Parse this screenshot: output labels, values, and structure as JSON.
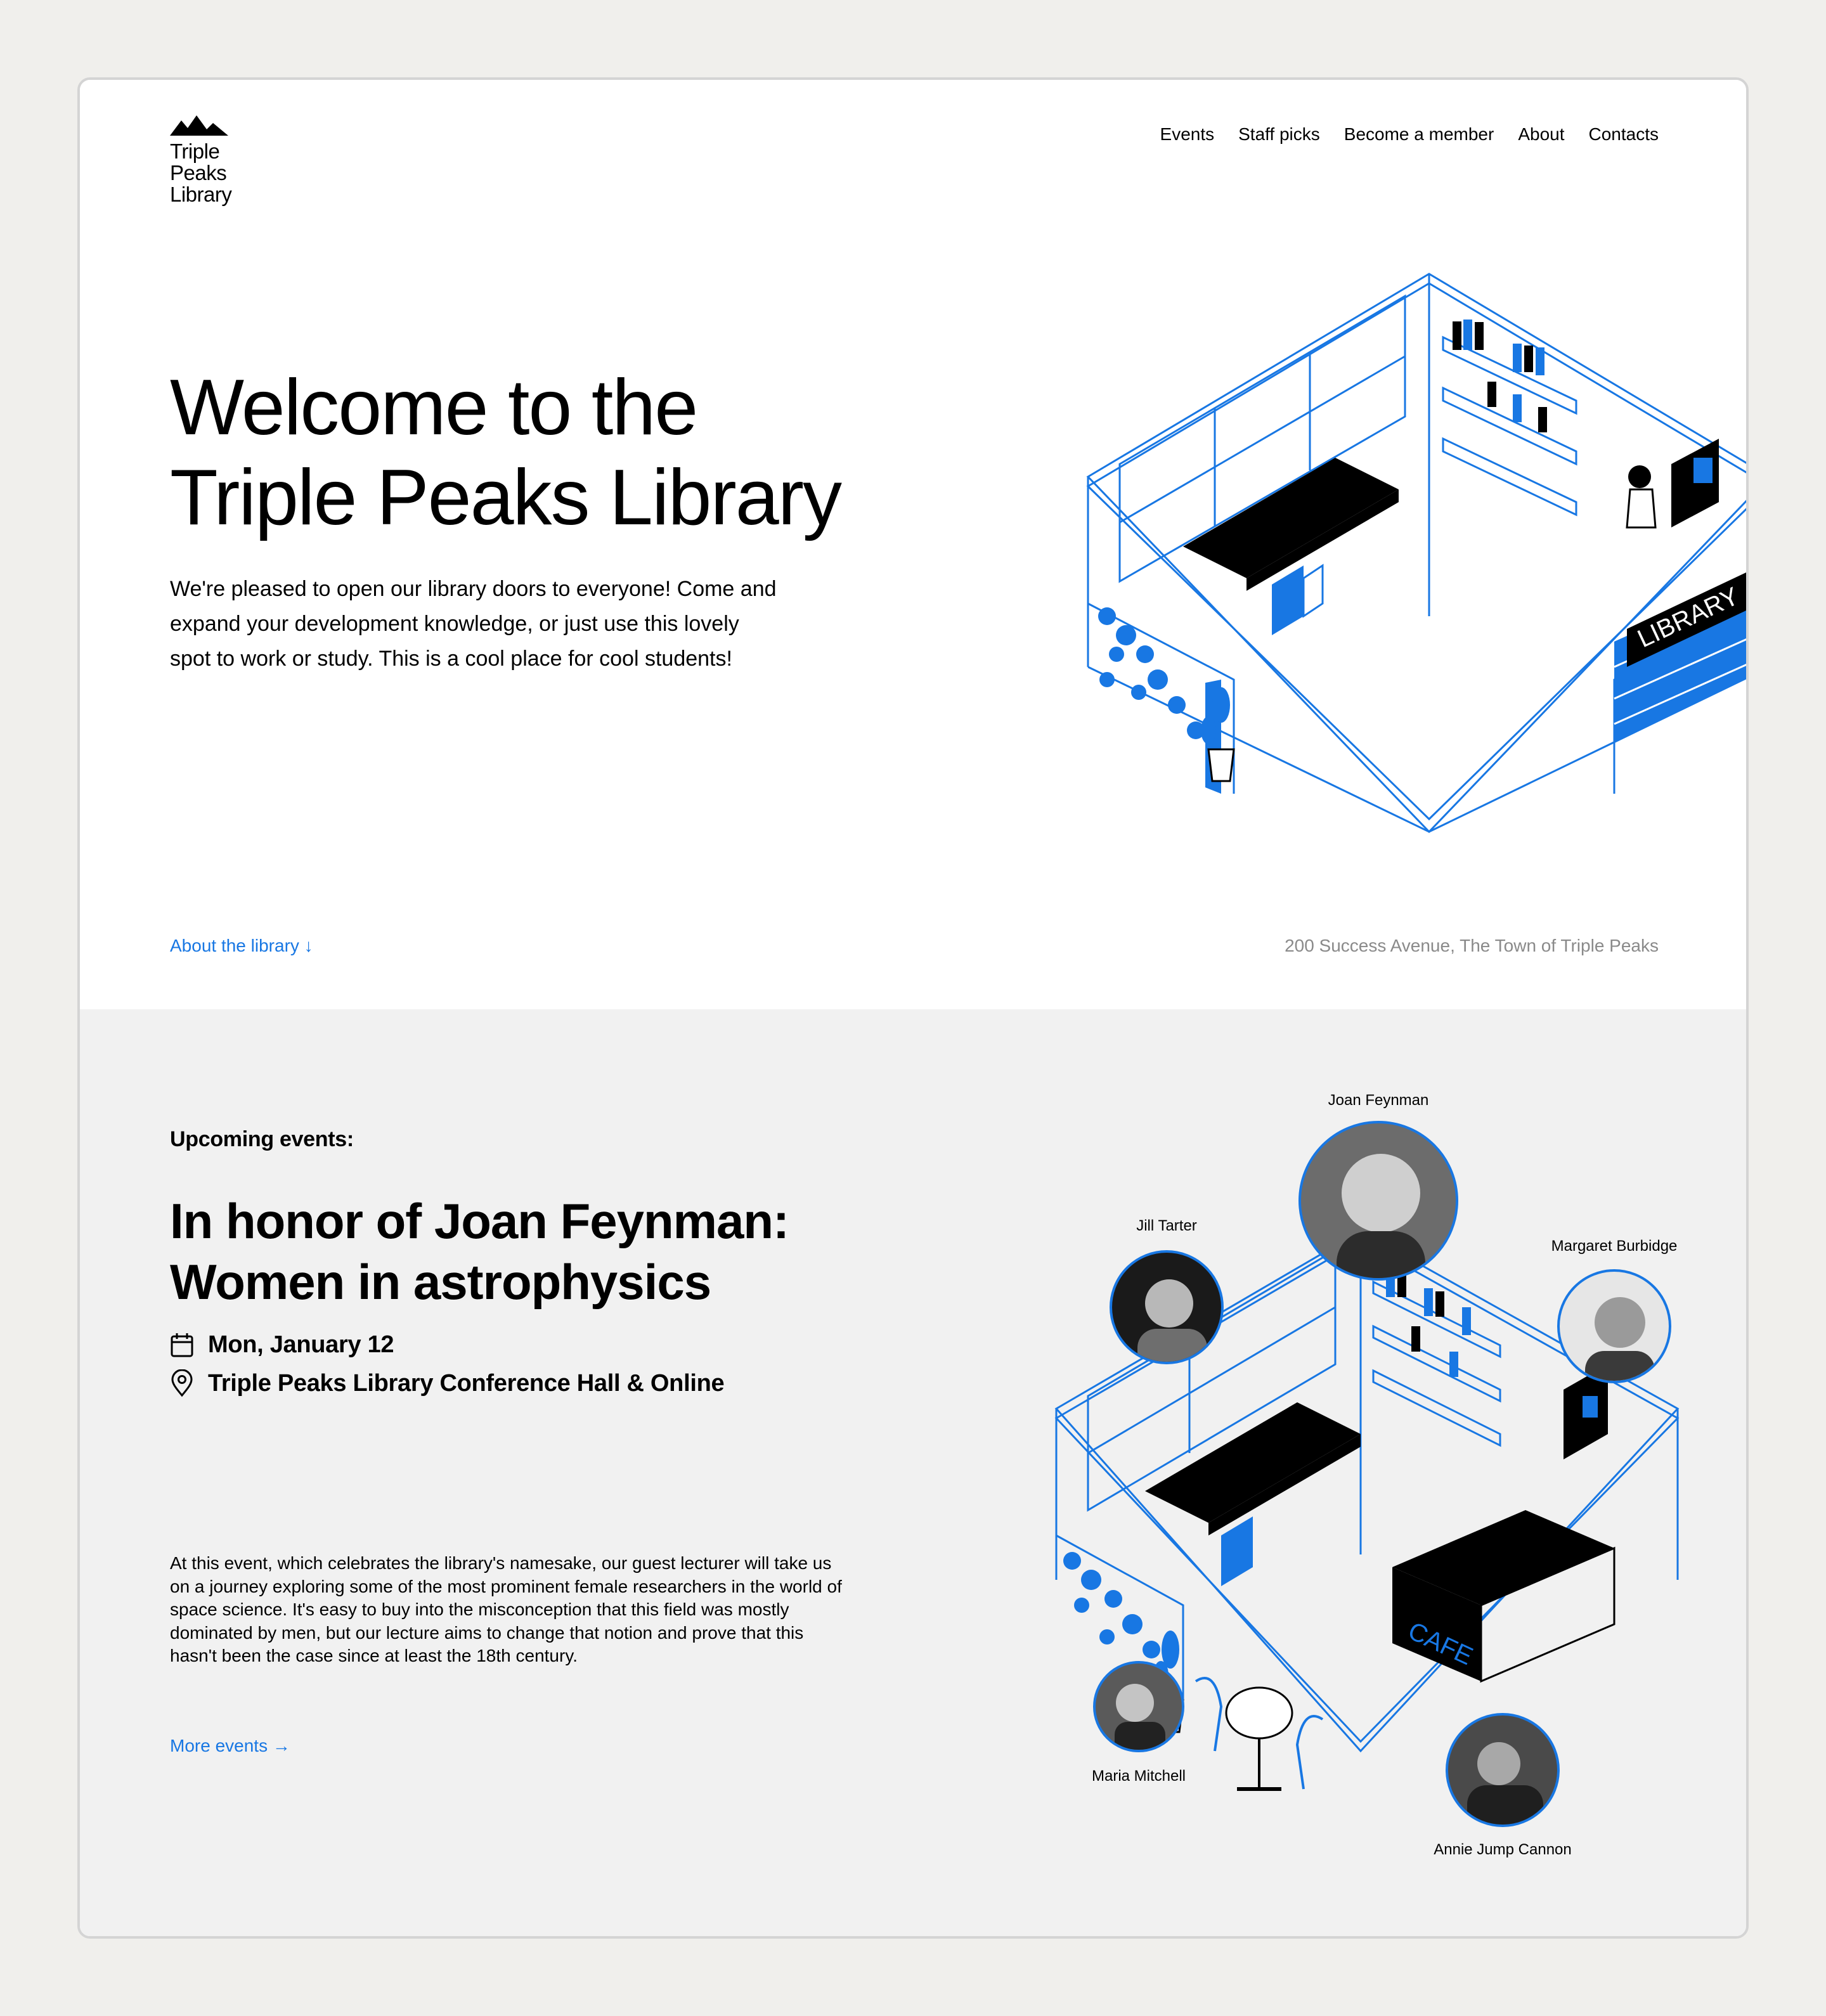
{
  "logo": {
    "line1": "Triple",
    "line2": "Peaks",
    "line3": "Library",
    "icon": "mountains-icon"
  },
  "nav": [
    "Events",
    "Staff picks",
    "Become a member",
    "About",
    "Contacts"
  ],
  "hero": {
    "title_line1": "Welcome to the",
    "title_line2": "Triple Peaks Library",
    "lead": "We're pleased to open our library doors to everyone! Come and expand your development knowledge, or just use this lovely spot to work or study. This is a cool place for cool students!",
    "about_link": "About the library ↓",
    "address": "200 Success Avenue, The Town of Triple Peaks",
    "sign_text": "LIBRARY"
  },
  "events": {
    "label": "Upcoming events:",
    "title_line1": "In honor of Joan Feynman:",
    "title_line2": "Women in astrophysics",
    "date": "Mon, January 12",
    "location": "Triple Peaks Library Conference Hall & Online",
    "description": "At this event, which celebrates the library's namesake, our guest lecturer will take us on a journey exploring some of the most prominent female researchers in the world of space science. It's easy to buy into the misconception that this field was mostly dominated by men, but our lecture aims to change that notion and prove that this hasn't been the case since at least the 18th century.",
    "more_link": "More events →",
    "cafe_sign": "CAFE",
    "people": [
      "Joan Feynman",
      "Jill Tarter",
      "Margaret Burbidge",
      "Maria Mitchell",
      "Annie Jump Cannon"
    ]
  },
  "colors": {
    "accent": "#1877e3",
    "background": "#f0efec",
    "events_bg": "#f1f1f1"
  }
}
